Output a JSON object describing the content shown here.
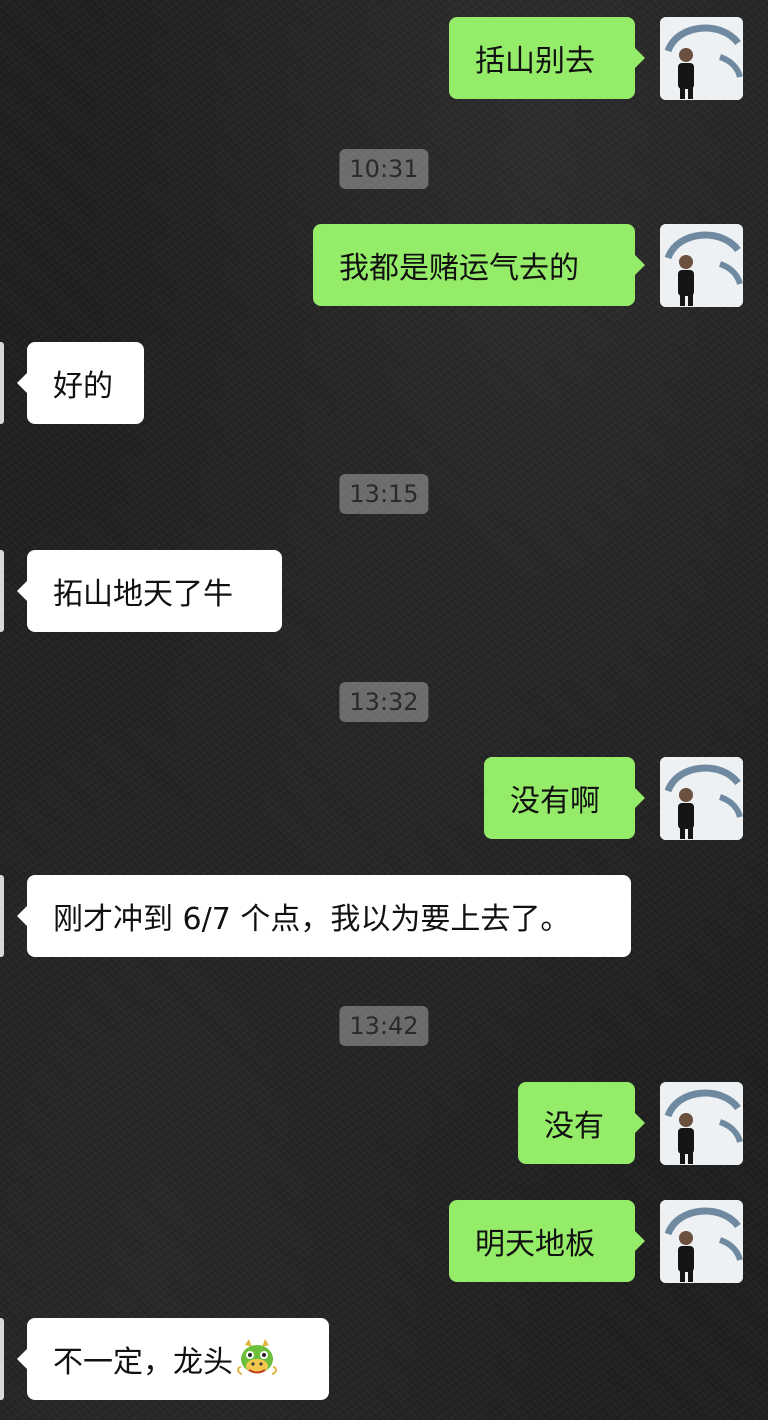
{
  "messages": [
    {
      "id": "m1",
      "side": "me",
      "text": "括山别去"
    },
    {
      "id": "t1",
      "type": "time",
      "text": "10:31"
    },
    {
      "id": "m2",
      "side": "me",
      "text": "我都是赌运气去的"
    },
    {
      "id": "m3",
      "side": "other",
      "text": "好的"
    },
    {
      "id": "t2",
      "type": "time",
      "text": "13:15"
    },
    {
      "id": "m4",
      "side": "other",
      "text": "拓山地天了牛"
    },
    {
      "id": "t3",
      "type": "time",
      "text": "13:32"
    },
    {
      "id": "m5",
      "side": "me",
      "text": "没有啊"
    },
    {
      "id": "m6",
      "side": "other",
      "text": "刚才冲到 6/7 个点，我以为要上去了。"
    },
    {
      "id": "t4",
      "type": "time",
      "text": "13:42"
    },
    {
      "id": "m7",
      "side": "me",
      "text": "没有"
    },
    {
      "id": "m8",
      "side": "me",
      "text": "明天地板"
    },
    {
      "id": "m9",
      "side": "other",
      "text": "不一定，龙头",
      "emoji": "dragon-face"
    }
  ],
  "colors": {
    "my_bubble": "#95ec69",
    "peer_bubble": "#ffffff",
    "background": "#1f1f1f"
  }
}
